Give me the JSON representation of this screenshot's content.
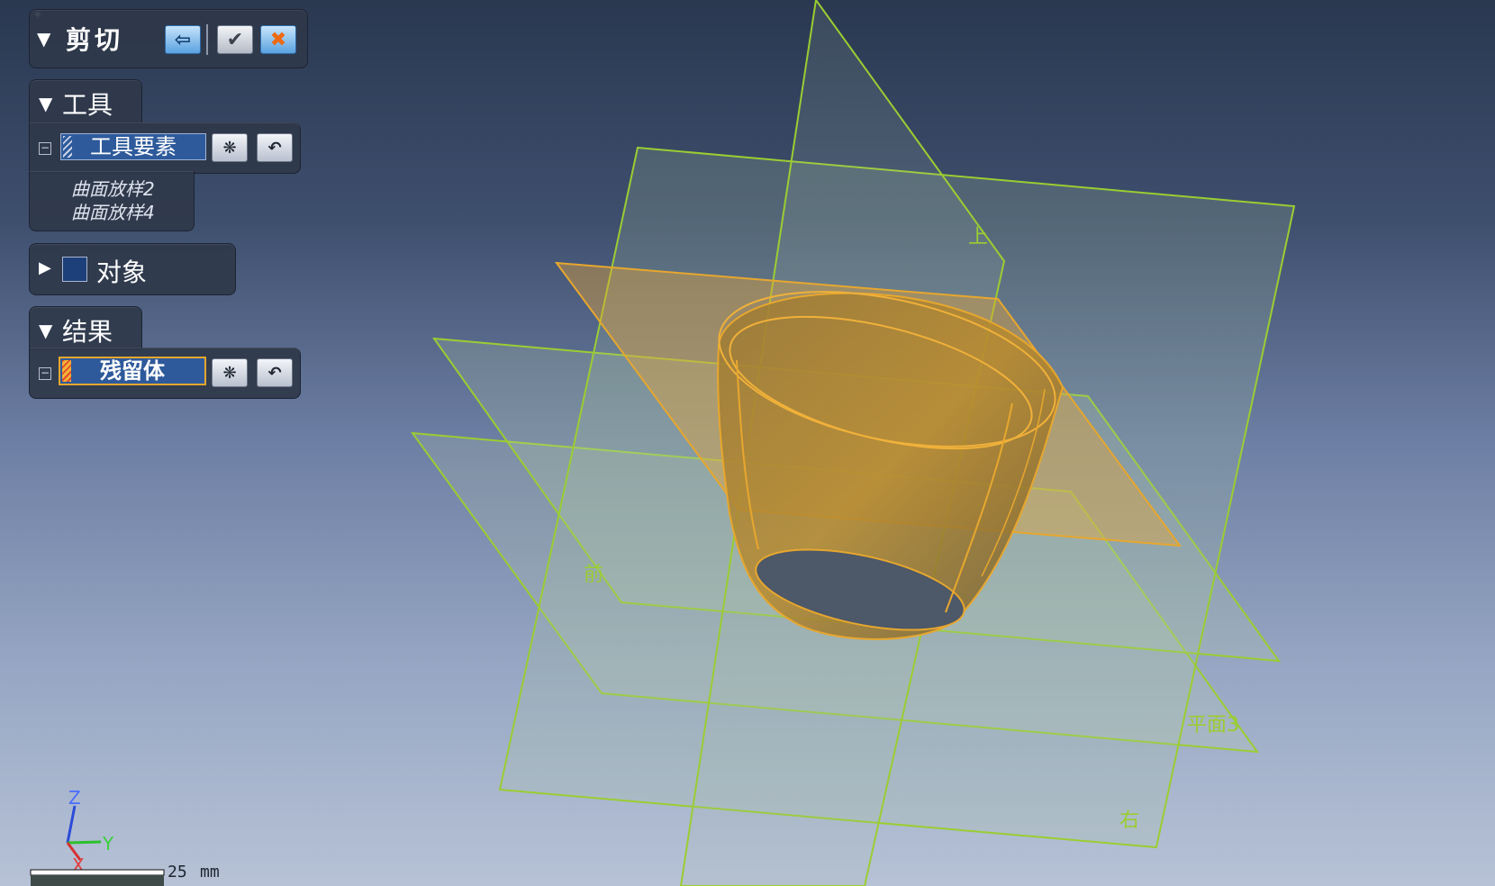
{
  "command": {
    "title": "剪切",
    "back_icon": "arrow-back-icon",
    "ok_icon": "checkmark-icon",
    "cancel_icon": "close-icon"
  },
  "tools": {
    "section_label": "工具",
    "field_value": "工具要素",
    "items": [
      "曲面放样2",
      "曲面放样4"
    ]
  },
  "objects": {
    "section_label": "对象"
  },
  "results": {
    "section_label": "结果",
    "field_value": "残留体"
  },
  "planes": {
    "top": "上",
    "front": "前",
    "right": "右",
    "plane3": "平面3"
  },
  "axes": {
    "z": "Z",
    "y": "Y",
    "x": "X"
  },
  "scale": {
    "value": "25",
    "unit": "mm"
  },
  "colors": {
    "accent": "#e7a72e",
    "plane_green": "#9acd32",
    "panel_bg": "#2f384a"
  }
}
